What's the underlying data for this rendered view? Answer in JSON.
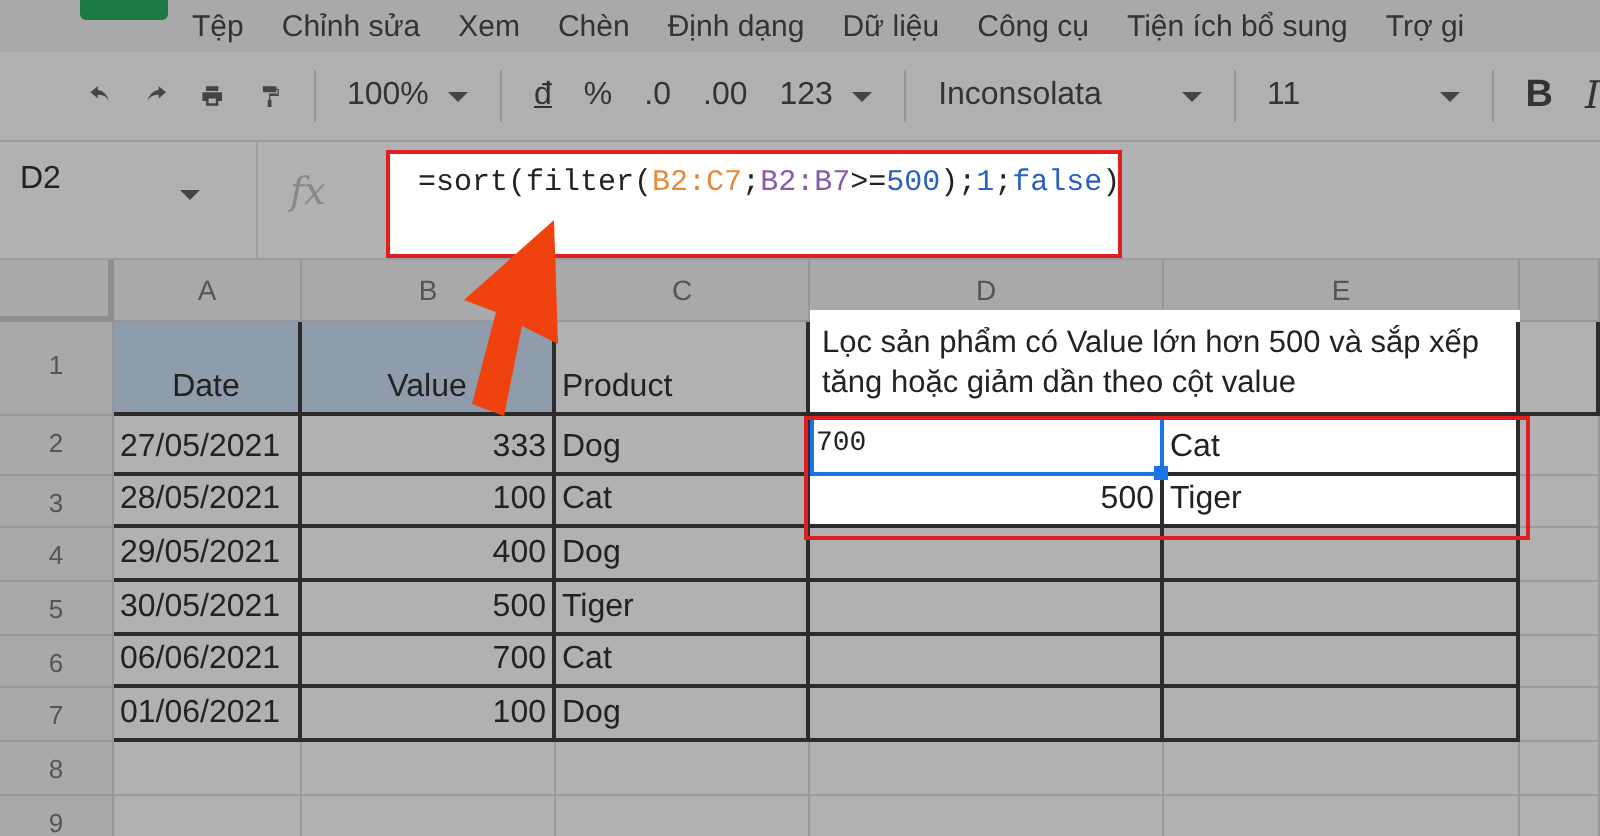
{
  "menu": [
    "Tệp",
    "Chỉnh sửa",
    "Xem",
    "Chèn",
    "Định dạng",
    "Dữ liệu",
    "Công cụ",
    "Tiện ích bổ sung",
    "Trợ gi"
  ],
  "toolbar": {
    "zoom": "100%",
    "currency": "đ",
    "percent": "%",
    "decimal_less": ".0",
    "decimal_more": ".00",
    "number_format": "123",
    "font": "Inconsolata",
    "font_size": "11",
    "bold": "B",
    "italic": "I"
  },
  "name_box": "D2",
  "fx": "fx",
  "formula": [
    {
      "text": "=sort(filter(",
      "kind": "plain"
    },
    {
      "text": "B2:C7",
      "kind": "range1"
    },
    {
      "text": ";",
      "kind": "plain"
    },
    {
      "text": "B2:B7",
      "kind": "range2"
    },
    {
      "text": ">=",
      "kind": "plain"
    },
    {
      "text": "500",
      "kind": "number"
    },
    {
      "text": ");",
      "kind": "plain"
    },
    {
      "text": "1",
      "kind": "number"
    },
    {
      "text": ";",
      "kind": "plain"
    },
    {
      "text": "false",
      "kind": "number"
    },
    {
      "text": ")",
      "kind": "plain"
    }
  ],
  "columns": [
    "A",
    "B",
    "C",
    "D",
    "E"
  ],
  "rows": [
    {
      "number": "1",
      "cells": [
        {
          "text": "Date",
          "kind": "header",
          "selected": false
        },
        {
          "text": "Value",
          "kind": "header",
          "selected": false
        },
        {
          "text": "Product",
          "kind": "text",
          "selected": false
        },
        {
          "text": "Lọc sản phẩm có Value lớn hơn 500 và sắp xếp tăng hoặc giảm dần theo cột value",
          "kind": "note",
          "selected": false
        }
      ]
    },
    {
      "number": "2",
      "cells": [
        {
          "text": "27/05/2021",
          "kind": "text",
          "selected": false
        },
        {
          "text": "333",
          "kind": "number",
          "selected": false
        },
        {
          "text": "Dog",
          "kind": "text",
          "selected": false
        },
        {
          "text": "700",
          "kind": "mono",
          "selected": true
        },
        {
          "text": "Cat",
          "kind": "text",
          "selected": false
        }
      ]
    },
    {
      "number": "3",
      "cells": [
        {
          "text": "28/05/2021",
          "kind": "text",
          "selected": false
        },
        {
          "text": "100",
          "kind": "number",
          "selected": false
        },
        {
          "text": "Cat",
          "kind": "text",
          "selected": false
        },
        {
          "text": "500",
          "kind": "number",
          "selected": false
        },
        {
          "text": "Tiger",
          "kind": "text",
          "selected": false
        }
      ]
    },
    {
      "number": "4",
      "cells": [
        {
          "text": "29/05/2021",
          "kind": "text",
          "selected": false
        },
        {
          "text": "400",
          "kind": "number",
          "selected": false
        },
        {
          "text": "Dog",
          "kind": "text",
          "selected": false
        },
        {
          "kind": "empty",
          "selected": false
        },
        {
          "kind": "empty",
          "selected": false
        }
      ]
    },
    {
      "number": "5",
      "cells": [
        {
          "text": "30/05/2021",
          "kind": "text",
          "selected": false
        },
        {
          "text": "500",
          "kind": "number",
          "selected": false
        },
        {
          "text": "Tiger",
          "kind": "text",
          "selected": false
        },
        {
          "kind": "empty",
          "selected": false
        },
        {
          "kind": "empty",
          "selected": false
        }
      ]
    },
    {
      "number": "6",
      "cells": [
        {
          "text": "06/06/2021",
          "kind": "text",
          "selected": false
        },
        {
          "text": "700",
          "kind": "number",
          "selected": false
        },
        {
          "text": "Cat",
          "kind": "text",
          "selected": false
        },
        {
          "kind": "empty",
          "selected": false
        },
        {
          "kind": "empty",
          "selected": false
        }
      ]
    },
    {
      "number": "7",
      "cells": [
        {
          "text": "01/06/2021",
          "kind": "text",
          "selected": false
        },
        {
          "text": "100",
          "kind": "number",
          "selected": false
        },
        {
          "text": "Dog",
          "kind": "text",
          "selected": false
        },
        {
          "kind": "empty",
          "selected": false
        },
        {
          "kind": "empty",
          "selected": false
        }
      ]
    },
    {
      "number": "8",
      "cells": []
    },
    {
      "number": "9",
      "cells": []
    }
  ]
}
